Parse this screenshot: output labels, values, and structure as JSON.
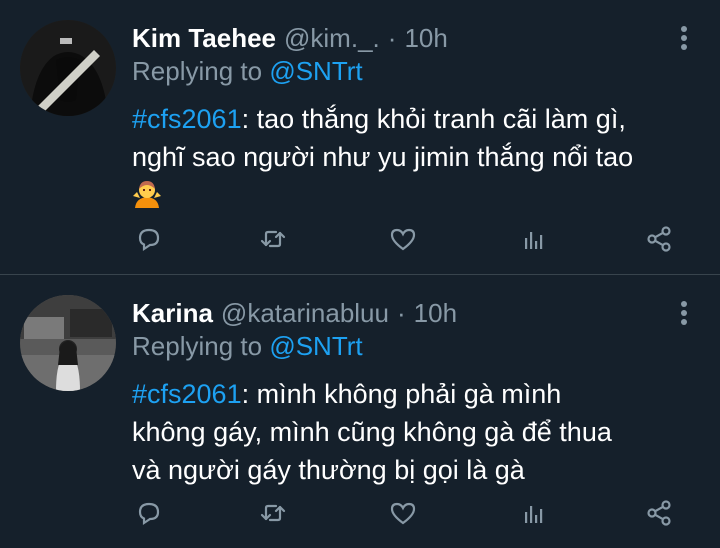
{
  "tweets": [
    {
      "name": "Kim Taehee",
      "handle": "@kim._.",
      "separator": "·",
      "time": "10h",
      "replying_prefix": "Replying to",
      "replying_to": "@SNTrt",
      "hashtag": "#cfs2061",
      "text_line1": ": tao thắng khỏi tranh cãi làm gì,",
      "text_line2": "nghĩ sao người như yu jimin thắng nổi tao",
      "emoji": "person-shrugging-emoji"
    },
    {
      "name": "Karina",
      "handle": "@katarinabluu",
      "separator": "·",
      "time": "10h",
      "replying_prefix": "Replying to",
      "replying_to": "@SNTrt",
      "hashtag": "#cfs2061",
      "text_line1": ": mình không phải gà mình",
      "text_line2": "không gáy, mình cũng không gà để thua",
      "text_line3": "và người gáy thường bị gọi là gà"
    }
  ],
  "colors": {
    "background": "#15202b",
    "accent": "#1da1f2",
    "muted": "#8899a6",
    "divider": "#38444d"
  },
  "icons": [
    "reply-icon",
    "retweet-icon",
    "like-icon",
    "analytics-icon",
    "share-icon",
    "more-icon"
  ]
}
